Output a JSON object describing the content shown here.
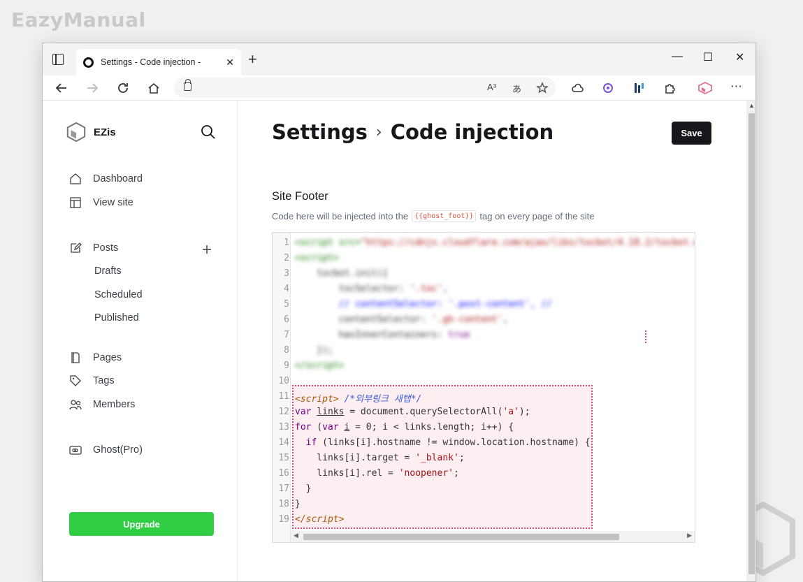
{
  "watermark": "EazyManual",
  "browser": {
    "tab_title": "Settings - Code injection -",
    "tab_close": "✕",
    "new_tab": "+",
    "minimize": "—",
    "maximize": "☐",
    "close": "✕",
    "address": "",
    "read_aloud": "A³",
    "translate": "あ",
    "more": "⋯"
  },
  "sidebar": {
    "brand": "EZis",
    "nav": {
      "dashboard": "Dashboard",
      "view_site": "View site",
      "posts": "Posts",
      "drafts": "Drafts",
      "scheduled": "Scheduled",
      "published": "Published",
      "pages": "Pages",
      "tags": "Tags",
      "members": "Members",
      "ghost_pro": "Ghost(Pro)"
    },
    "posts_add": "+",
    "upgrade": "Upgrade"
  },
  "main": {
    "crumb_parent": "Settings",
    "crumb_sep": "›",
    "crumb_current": "Code injection",
    "save": "Save",
    "section_title": "Site Footer",
    "desc_before": "Code here will be injected into the",
    "desc_code": "{{ghost_foot}}",
    "desc_after": "tag on every page of the site",
    "line_numbers": [
      "1",
      "2",
      "3",
      "4",
      "5",
      "6",
      "7",
      "8",
      "9",
      "10",
      "11",
      "12",
      "13",
      "14",
      "15",
      "16",
      "17",
      "18",
      "19"
    ]
  }
}
